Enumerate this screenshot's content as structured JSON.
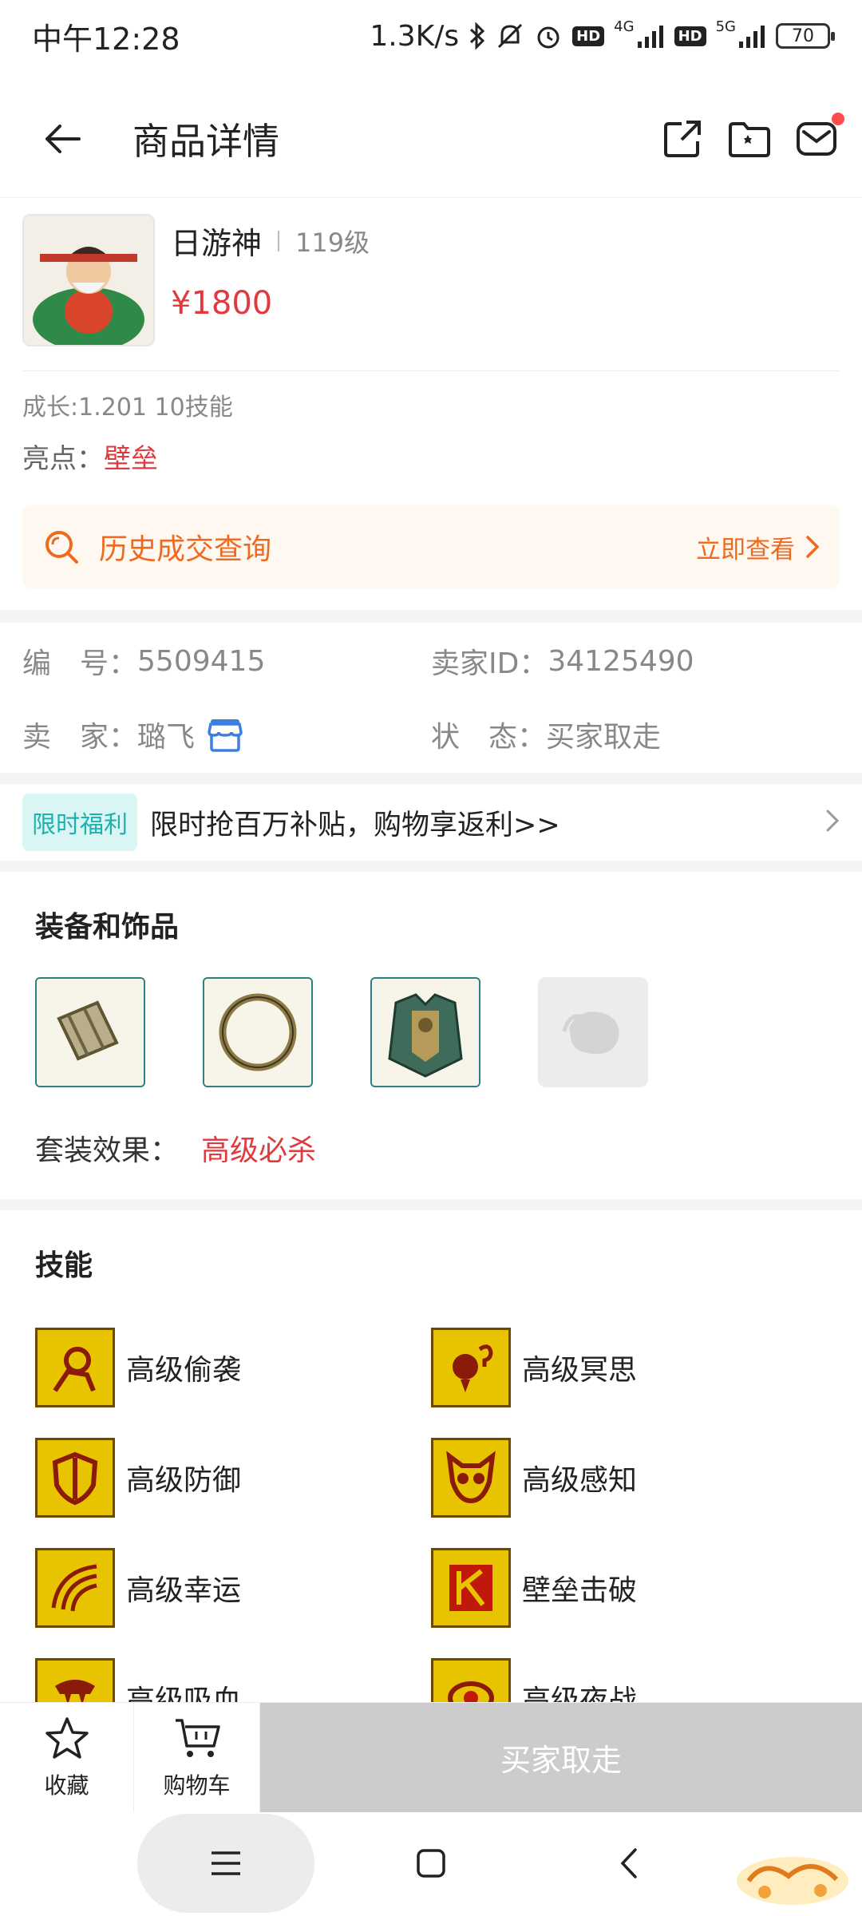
{
  "status_bar": {
    "time": "中午12:28",
    "speed": "1.3K/s",
    "net1": "4G",
    "net2": "5G",
    "hd": "HD",
    "battery": "70"
  },
  "header": {
    "title": "商品详情"
  },
  "product": {
    "name": "日游神",
    "level": "119级",
    "price": "¥1800",
    "growth": "成长:1.201 10技能",
    "highlight_label": "亮点：",
    "highlight_value": "壁垒",
    "history_label": "历史成交查询",
    "history_link": "立即查看"
  },
  "meta": {
    "id_label": "编　号：",
    "id_value": "5509415",
    "seller_id_label": "卖家ID：",
    "seller_id_value": "34125490",
    "seller_label": "卖　家：",
    "seller_value": "璐飞",
    "status_label": "状　态：",
    "status_value": "买家取走"
  },
  "promo": {
    "tag": "限时福利",
    "text": "限时抢百万补贴，购物享返利>>"
  },
  "equipment": {
    "title": "装备和饰品",
    "suit_label": "套装效果：",
    "suit_value": "高级必杀"
  },
  "skills": {
    "title": "技能",
    "items": [
      {
        "name": "高级偷袭"
      },
      {
        "name": "高级冥思"
      },
      {
        "name": "高级防御"
      },
      {
        "name": "高级感知"
      },
      {
        "name": "高级幸运"
      },
      {
        "name": "壁垒击破"
      },
      {
        "name": "高级吸血"
      },
      {
        "name": "高级夜战"
      }
    ]
  },
  "bottom": {
    "favorite": "收藏",
    "cart": "购物车",
    "buy": "买家取走"
  },
  "colors": {
    "price_red": "#e0393e",
    "history_orange": "#ee6a1f",
    "promo_teal": "#1bb3ad",
    "skill_gold": "#e8c400",
    "disabled_gray": "#cccccc"
  }
}
